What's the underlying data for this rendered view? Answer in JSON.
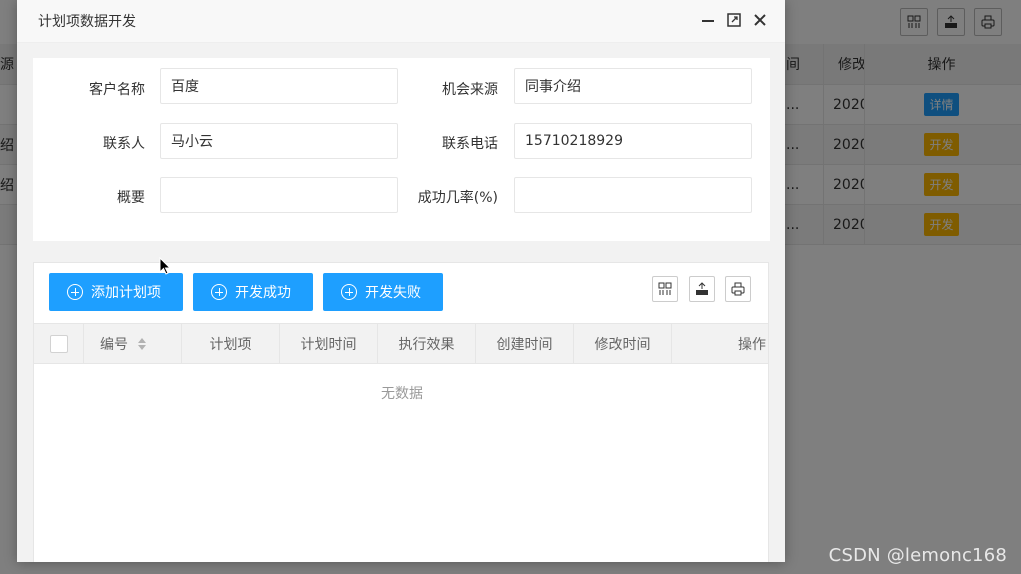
{
  "background": {
    "header_cols": {
      "col_source": "源",
      "col_time": "间",
      "col_modify": "修改",
      "col_action": "操作"
    },
    "rows": [
      {
        "source": "",
        "time": "...",
        "modify": "2020",
        "action": "详情",
        "action_color": "#1e9fff"
      },
      {
        "source": "绍",
        "time": "...",
        "modify": "2020",
        "action": "开发",
        "action_color": "#ffb800"
      },
      {
        "source": "绍",
        "time": "...",
        "modify": "2020",
        "action": "开发",
        "action_color": "#ffb800"
      },
      {
        "source": "",
        "time": "...",
        "modify": "2020",
        "action": "开发",
        "action_color": "#ffb800"
      }
    ],
    "toolbar_icons": [
      "columns-icon",
      "export-icon",
      "print-icon"
    ]
  },
  "dialog": {
    "title": "计划项数据开发",
    "controls": [
      "minimize-icon",
      "maximize-icon",
      "close-icon"
    ],
    "form": {
      "customer_name_label": "客户名称",
      "customer_name_value": "百度",
      "opportunity_source_label": "机会来源",
      "opportunity_source_value": "同事介绍",
      "contact_label": "联系人",
      "contact_value": "马小云",
      "phone_label": "联系电话",
      "phone_value": "15710218929",
      "summary_label": "概要",
      "summary_value": "",
      "success_rate_label": "成功几率(%)",
      "success_rate_value": ""
    },
    "toolbar": {
      "add_plan_label": "添加计划项",
      "dev_success_label": "开发成功",
      "dev_fail_label": "开发失败",
      "accent_color": "#1e9fff",
      "icons": [
        "columns-icon",
        "export-icon",
        "print-icon"
      ]
    },
    "table": {
      "columns": [
        "编号",
        "计划项",
        "计划时间",
        "执行效果",
        "创建时间",
        "修改时间",
        "操作"
      ],
      "empty_text": "无数据"
    }
  },
  "watermark": "CSDN @lemonc168"
}
